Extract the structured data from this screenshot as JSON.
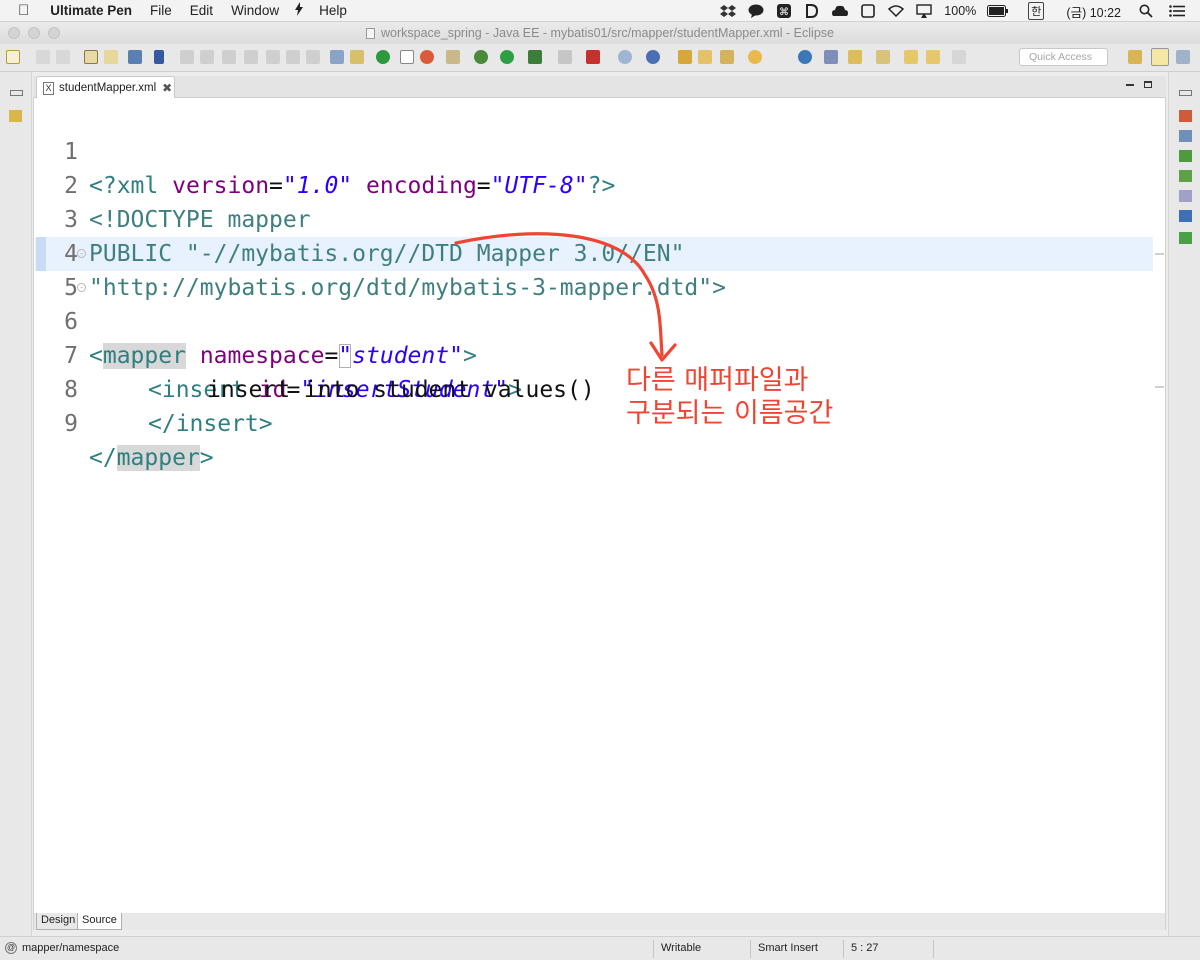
{
  "menubar": {
    "app_name": "Ultimate Pen",
    "items": [
      "File",
      "Edit",
      "Window",
      "Help"
    ],
    "battery": "100%",
    "input_method": "한",
    "clock": "(금) 10:22"
  },
  "window": {
    "title": "workspace_spring - Java EE - mybatis01/src/mapper/studentMapper.xml - Eclipse"
  },
  "toolbar": {
    "quick_access_placeholder": "Quick Access"
  },
  "editor": {
    "tab_label": "studentMapper.xml",
    "tab_icon_text": "X",
    "lines": [
      {
        "num": "1"
      },
      {
        "num": "2"
      },
      {
        "num": "3"
      },
      {
        "num": "4"
      },
      {
        "num": "5"
      },
      {
        "num": "6"
      },
      {
        "num": "7"
      },
      {
        "num": "8"
      },
      {
        "num": "9"
      }
    ],
    "code": {
      "l1_open": "<?xml",
      "l1_attr1": "version",
      "l1_eq1": "=",
      "l1_val1": "\"1.0\"",
      "l1_attr2": "encoding",
      "l1_eq2": "=",
      "l1_val2": "\"UTF-8\"",
      "l1_close": "?>",
      "l2": "<!DOCTYPE mapper",
      "l3": "PUBLIC \"-//mybatis.org//DTD Mapper 3.0//EN\"",
      "l4": "\"http://mybatis.org/dtd/mybatis-3-mapper.dtd\">",
      "l5_lt": "<",
      "l5_tag": "mapper",
      "l5_attr": "namespace",
      "l5_eq": "=",
      "l5_q": "\"",
      "l5_val": "student\"",
      "l5_close": ">",
      "l6_tag": "<insert",
      "l6_attr": "id",
      "l6_eq": "=",
      "l6_val": "\"insertStudent\"",
      "l6_close": ">",
      "l7": "insert into student values()",
      "l8": "</insert>",
      "l9_lt": "</",
      "l9_tag": "mapper",
      "l9_close": ">"
    },
    "bottom_tabs": [
      "Design",
      "Source"
    ]
  },
  "annotation": {
    "line1": "다른 매퍼파일과",
    "line2": "구분되는 이름공간",
    "color": "#ef4533"
  },
  "statusbar": {
    "path": "mapper/namespace",
    "writable": "Writable",
    "insert_mode": "Smart Insert",
    "position": "5 : 27"
  }
}
